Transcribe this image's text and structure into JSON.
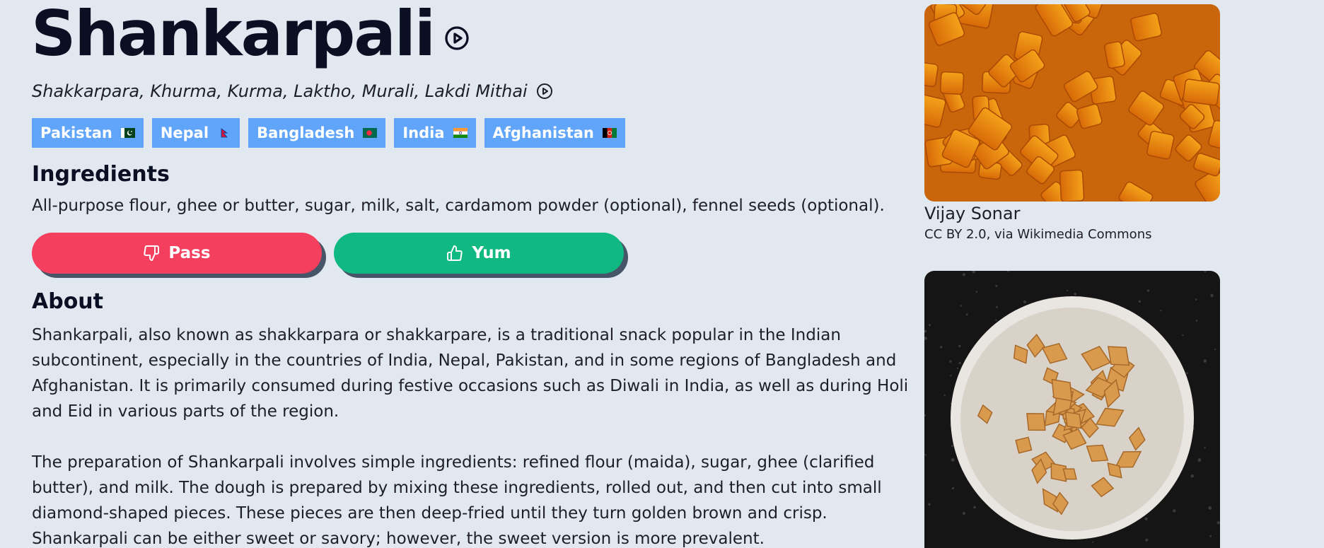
{
  "dish": {
    "name": "Shankarpali",
    "alt_names": "Shakkarpara, Khurma, Kurma, Laktho, Murali, Lakdi Mithai"
  },
  "countries": [
    {
      "name": "Pakistan",
      "flag": "pakistan-flag"
    },
    {
      "name": "Nepal",
      "flag": "nepal-flag"
    },
    {
      "name": "Bangladesh",
      "flag": "bangladesh-flag"
    },
    {
      "name": "India",
      "flag": "india-flag"
    },
    {
      "name": "Afghanistan",
      "flag": "afghanistan-flag"
    }
  ],
  "ingredients": {
    "heading": "Ingredients",
    "text": "All-purpose flour, ghee or butter, sugar, milk, salt, cardamom powder (optional), fennel seeds (optional)."
  },
  "actions": {
    "pass_label": "Pass",
    "yum_label": "Yum"
  },
  "about": {
    "heading": "About",
    "paragraphs": [
      "Shankarpali, also known as shakkarpara or shakkarpare, is a traditional snack popular in the Indian subcontinent, especially in the countries of India, Nepal, Pakistan, and in some regions of Bangladesh and Afghanistan. It is primarily consumed during festive occasions such as Diwali in India, as well as during Holi and Eid in various parts of the region.",
      "The preparation of Shankarpali involves simple ingredients: refined flour (maida), sugar, ghee (clarified butter), and milk. The dough is prepared by mixing these ingredients, rolled out, and then cut into small diamond-shaped pieces. These pieces are then deep-fried until they turn golden brown and crisp. Shankarpali can be either sweet or savory; however, the sweet version is more prevalent."
    ]
  },
  "photos": [
    {
      "author": "Vijay Sonar",
      "license": "CC BY 2.0, via Wikimedia Commons"
    }
  ],
  "colors": {
    "background": "#e2e8f0",
    "tag": "#60a5fa",
    "pass": "#f43f5e",
    "yum": "#10b981"
  }
}
